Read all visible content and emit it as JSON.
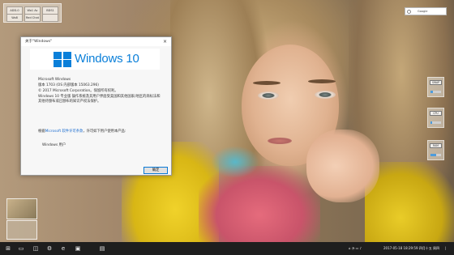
{
  "desktop": {
    "info_widget": {
      "cells": [
        "ADD-0",
        "Wo1 Av",
        "BDS1",
        "Wo8",
        "Red Chat",
        ""
      ]
    },
    "search": {
      "placeholder": "Google"
    },
    "gadgets": [
      {
        "label": "SWAP",
        "percent": 20
      },
      {
        "label": "CPU",
        "percent": 15
      },
      {
        "label": "RAM",
        "percent": 55
      }
    ]
  },
  "dialog": {
    "title": "关于\"Windows\"",
    "close_glyph": "×",
    "wordmark": "Windows 10",
    "lines": {
      "product": "Microsoft Windows",
      "version": "版本 1703 (OS 内部版本 15063.296)",
      "copyright": "© 2017 Microsoft Corporation。保留所有权利。",
      "description_1": "Windows 10 专业版 操作系统及其用户界面受美国和其他国家/地区的商标法和",
      "description_2": "其他待颁布或已颁布的知识产权法保护。",
      "license_prefix": "根据",
      "license_link": "Microsoft 软件许可条款",
      "license_suffix": "，许可如下用户使用本产品:",
      "licensed_user": "Windows 用户"
    },
    "ok_label": "确定"
  },
  "taskbar": {
    "icons": [
      "start-icon",
      "task-view-icon",
      "window-icon",
      "settings-icon",
      "edge-icon",
      "explorer-icon",
      "store-icon"
    ],
    "tray": {
      "datetime": "2017-05-18  18:29:59  四月十五 周四",
      "separator": "|"
    }
  }
}
